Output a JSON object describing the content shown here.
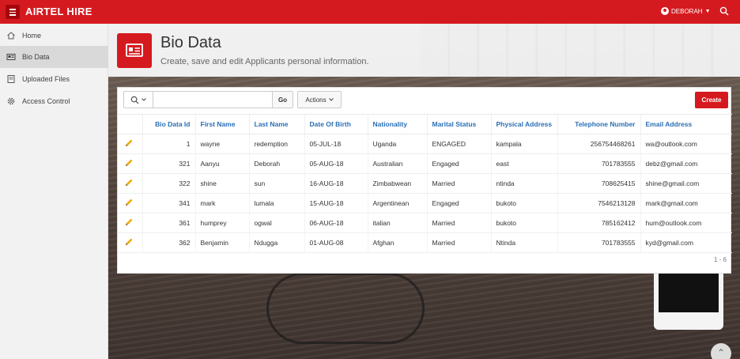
{
  "header": {
    "app_title": "AIRTEL HIRE",
    "user_name": "DEBORAH"
  },
  "sidebar": {
    "items": [
      {
        "label": "Home",
        "icon": "home-icon"
      },
      {
        "label": "Bio Data",
        "icon": "id-card-icon"
      },
      {
        "label": "Uploaded Files",
        "icon": "file-icon"
      },
      {
        "label": "Access Control",
        "icon": "gear-icon"
      }
    ]
  },
  "hero": {
    "title": "Bio Data",
    "subtitle": "Create, save and edit Applicants personal information."
  },
  "toolbar": {
    "search_value": "",
    "go_label": "Go",
    "actions_label": "Actions",
    "create_label": "Create"
  },
  "table": {
    "headers": [
      "Bio Data Id",
      "First Name",
      "Last Name",
      "Date Of Birth",
      "Nationality",
      "Marital Status",
      "Physical Address",
      "Telephone Number",
      "Email Address"
    ],
    "rows": [
      [
        "1",
        "wayne",
        "redemption",
        "05-JUL-18",
        "Uganda",
        "ENGAGED",
        "kampala",
        "256754468261",
        "wa@outlook.com"
      ],
      [
        "321",
        "Aanyu",
        "Deborah",
        "05-AUG-18",
        "Australian",
        "Engaged",
        "east",
        "701783555",
        "debz@gmail.com"
      ],
      [
        "322",
        "shine",
        "sun",
        "16-AUG-18",
        "Zimbabwean",
        "Married",
        "ntinda",
        "708625415",
        "shine@gmail.com"
      ],
      [
        "341",
        "mark",
        "lumala",
        "15-AUG-18",
        "Argentinean",
        "Engaged",
        "bukoto",
        "7546213128",
        "mark@gmail.com"
      ],
      [
        "361",
        "humprey",
        "ogwal",
        "06-AUG-18",
        "italian",
        "Married",
        "bukoto",
        "785162412",
        "hum@outlook.com"
      ],
      [
        "362",
        "Benjamin",
        "Ndugga",
        "01-AUG-08",
        "Afghan",
        "Married",
        "Ntinda",
        "701783555",
        "kyd@gmail.com"
      ]
    ]
  },
  "pagination": {
    "label": "1 - 6"
  },
  "colors": {
    "brand": "#d51a1f",
    "link": "#2a6fb5",
    "edit": "#f0a800"
  }
}
